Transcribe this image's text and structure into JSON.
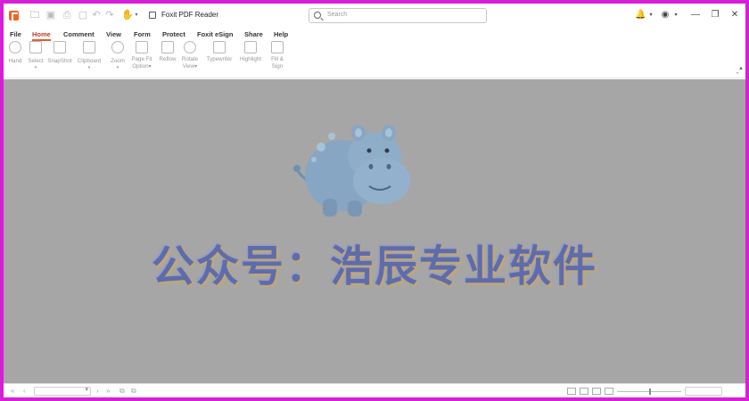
{
  "window": {
    "title": "Foxit PDF Reader",
    "search_placeholder": "Search"
  },
  "menu": {
    "tabs": [
      "File",
      "Home",
      "Comment",
      "View",
      "Form",
      "Protect",
      "Foxit eSign",
      "Share",
      "Help"
    ],
    "active_tab": "Home"
  },
  "ribbon": {
    "hand": "Hand",
    "select": "Select",
    "snapshot": "SnapShot",
    "clipboard": "Clipboard",
    "zoom": "Zoom",
    "page_fit_1": "Page Fit",
    "page_fit_2": "Option",
    "reflow": "Reflow",
    "rotate_1": "Rotate",
    "rotate_2": "View",
    "typewriter": "Typewriter",
    "highlight": "Highlight",
    "fill_sign_1": "Fill &",
    "fill_sign_2": "Sign"
  },
  "document": {
    "watermark_text": "公众号：浩辰专业软件"
  },
  "colors": {
    "frame_border": "#d61fd6",
    "document_bg": "#a6a6a6",
    "accent": "#e06020",
    "watermark": "#5e6cab"
  }
}
